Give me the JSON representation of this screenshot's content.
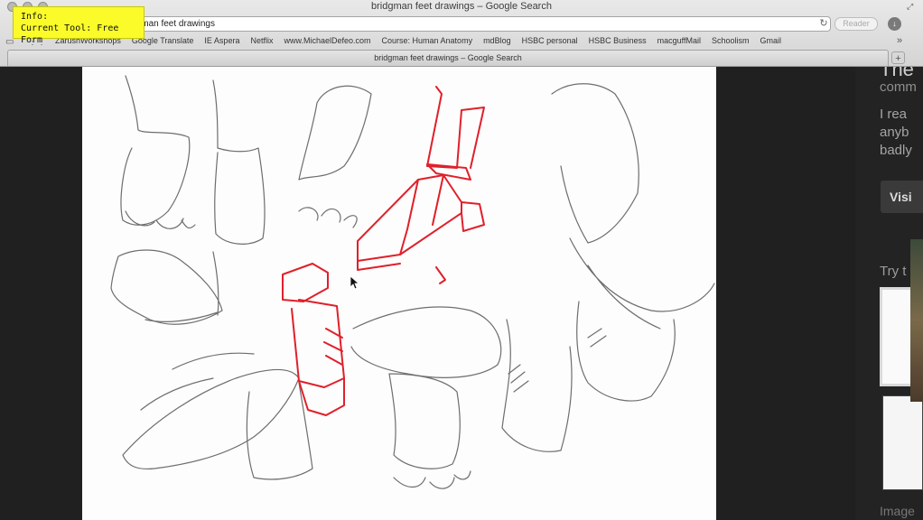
{
  "window": {
    "title": "bridgman feet drawings – Google Search"
  },
  "toolbar": {
    "url": "bridgman feet drawings",
    "reader_label": "Reader"
  },
  "bookmarks": [
    "ZarushWorkshops",
    "Google Translate",
    "IE Aspera",
    "Netflix",
    "www.MichaelDefeo.com",
    "Course: Human Anatomy",
    "mdBlog",
    "HSBC personal",
    "HSBC Business",
    "macguffMail",
    "Schoolism",
    "Gmail"
  ],
  "tab": {
    "title": "bridgman feet drawings – Google Search"
  },
  "overlay": {
    "info_line1": "Info:",
    "info_line2": "Current Tool: Free Form",
    "bg_color": "#fbfb29"
  },
  "sidebar": {
    "heading": "The",
    "comment": "comm",
    "lines": [
      "I rea",
      "anyb",
      "badly"
    ],
    "visit_label": "Visi",
    "try_label": "Try t",
    "images_label": "Image"
  },
  "icons": [
    "traffic-lights",
    "fullscreen-icon",
    "reload-icon",
    "download-icon",
    "bookmarks-book-icon",
    "apps-grid-icon",
    "more-bookmarks-icon",
    "new-tab-icon",
    "cursor-icon"
  ],
  "colors": {
    "sketch_red": "#e0202a",
    "pencil": "#4a4a4a"
  }
}
